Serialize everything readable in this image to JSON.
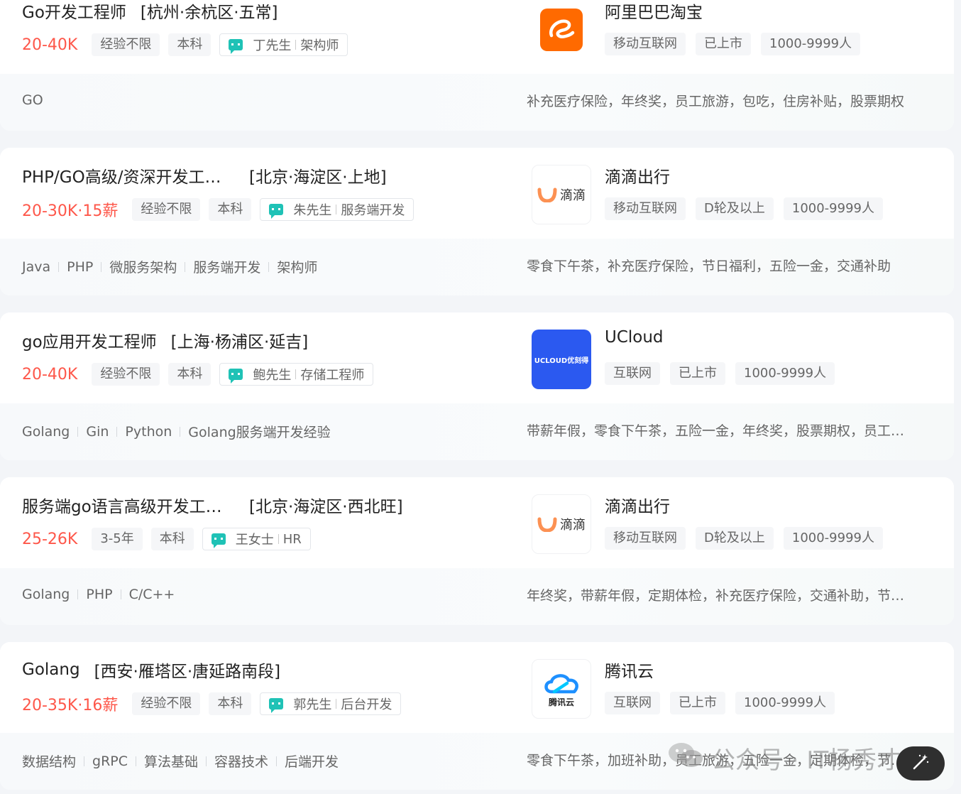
{
  "jobs": [
    {
      "title": "Go开发工程师",
      "area": "[杭州·余杭区·五常]",
      "salary": "20-40K",
      "tags": [
        "经验不限",
        "本科"
      ],
      "boss_name": "丁先生",
      "boss_title": "架构师",
      "company": "阿里巴巴淘宝",
      "company_tags": [
        "移动互联网",
        "已上市",
        "1000-9999人"
      ],
      "logo": "alibaba-logo",
      "skills": [
        "GO"
      ],
      "welfare": "补充医疗保险，年终奖，员工旅游，包吃，住房补贴，股票期权"
    },
    {
      "title": "PHP/GO高级/资深开发工程师",
      "area": "[北京·海淀区·上地]",
      "salary": "20-30K·15薪",
      "tags": [
        "经验不限",
        "本科"
      ],
      "boss_name": "朱先生",
      "boss_title": "服务端开发",
      "company": "滴滴出行",
      "company_tags": [
        "移动互联网",
        "D轮及以上",
        "1000-9999人"
      ],
      "logo": "didi-logo",
      "skills": [
        "Java",
        "PHP",
        "微服务架构",
        "服务端开发",
        "架构师"
      ],
      "welfare": "零食下午茶，补充医疗保险，节日福利，五险一金，交通补助"
    },
    {
      "title": "go应用开发工程师",
      "area": "[上海·杨浦区·延吉]",
      "salary": "20-40K",
      "tags": [
        "经验不限",
        "本科"
      ],
      "boss_name": "鲍先生",
      "boss_title": "存储工程师",
      "company": "UCloud",
      "company_tags": [
        "互联网",
        "已上市",
        "1000-9999人"
      ],
      "logo": "ucloud-logo",
      "skills": [
        "Golang",
        "Gin",
        "Python",
        "Golang服务端开发经验"
      ],
      "welfare": "带薪年假，零食下午茶，五险一金，年终奖，股票期权，员工旅游"
    },
    {
      "title": "服务端go语言高级开发工程师",
      "area": "[北京·海淀区·西北旺]",
      "salary": "25-26K",
      "tags": [
        "3-5年",
        "本科"
      ],
      "boss_name": "王女士",
      "boss_title": "HR",
      "company": "滴滴出行",
      "company_tags": [
        "移动互联网",
        "D轮及以上",
        "1000-9999人"
      ],
      "logo": "didi-logo",
      "skills": [
        "Golang",
        "PHP",
        "C/C++"
      ],
      "welfare": "年终奖，带薪年假，定期体检，补充医疗保险，交通补助，节日福利"
    },
    {
      "title": "Golang",
      "area": "[西安·雁塔区·唐延路南段]",
      "salary": "20-35K·16薪",
      "tags": [
        "经验不限",
        "本科"
      ],
      "boss_name": "郭先生",
      "boss_title": "后台开发",
      "company": "腾讯云",
      "company_tags": [
        "互联网",
        "已上市",
        "1000-9999人"
      ],
      "logo": "tencent-cloud-logo",
      "skills": [
        "数据结构",
        "gRPC",
        "算法基础",
        "容器技术",
        "后端开发"
      ],
      "welfare": "零食下午茶，加班补助，员工旅游，五险一金，定期体检，节日福利"
    }
  ],
  "logo_text": {
    "didi": "滴滴",
    "ucloud": "UCLOUD优刻得",
    "tencent": "腾讯云"
  },
  "watermark": "公众号 · IT杨秀才",
  "colors": {
    "salary": "#fe574a",
    "chat_icon": "#1fc2b6",
    "alibaba": "#ff6a00",
    "didi": "#fc9153",
    "ucloud": "#2b59f0",
    "tencent": "#1e90ff"
  }
}
